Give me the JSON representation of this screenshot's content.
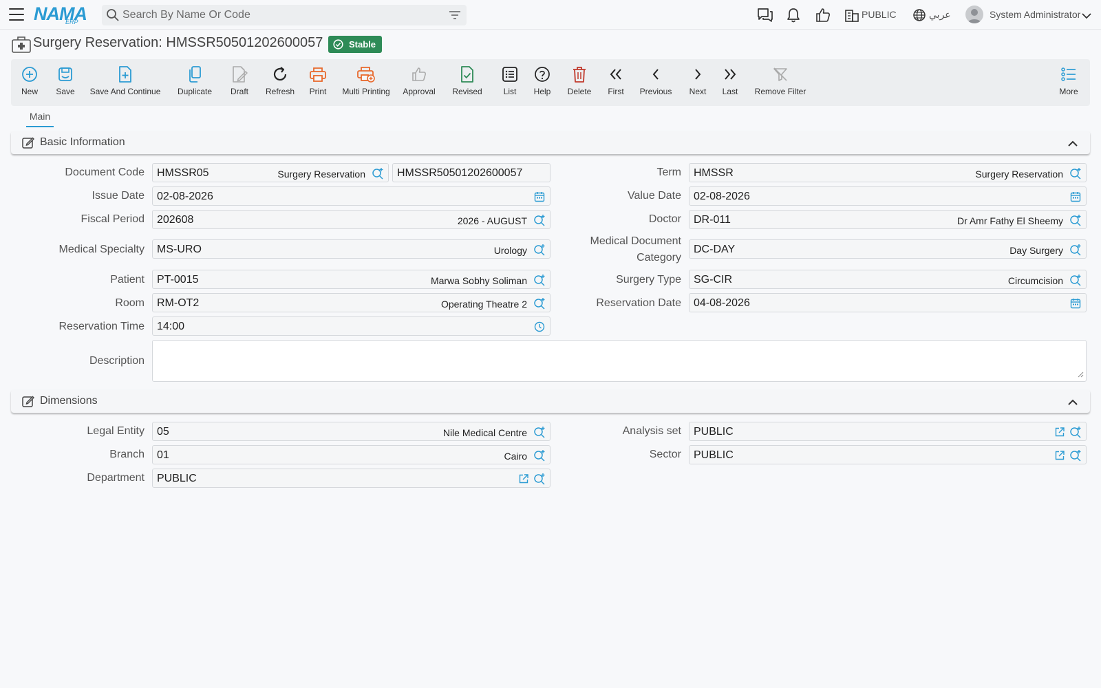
{
  "header": {
    "logo_main": "NAMA",
    "logo_sub": "ERP",
    "search_placeholder": "Search By Name Or Code",
    "org": "PUBLIC",
    "language": "عربي",
    "user": "System Administrator",
    "icons": [
      "menu-icon",
      "search-icon",
      "filter-icon",
      "chat-icon",
      "bell-icon",
      "thumbs-up-icon",
      "building-icon",
      "globe-icon",
      "user-icon",
      "chevron-down-icon"
    ]
  },
  "page": {
    "title": "Surgery Reservation: HMSSR50501202600057",
    "status": "Stable",
    "status_color": "#2e8b57"
  },
  "toolbar": {
    "new": "New",
    "save": "Save",
    "save_continue": "Save And Continue",
    "duplicate": "Duplicate",
    "draft": "Draft",
    "refresh": "Refresh",
    "print": "Print",
    "multi_printing": "Multi Printing",
    "approval": "Approval",
    "revised": "Revised",
    "list": "List",
    "help": "Help",
    "delete": "Delete",
    "first": "First",
    "previous": "Previous",
    "next": "Next",
    "last": "Last",
    "remove_filter": "Remove Filter",
    "more": "More"
  },
  "tabs": {
    "main": "Main"
  },
  "basic": {
    "title": "Basic Information",
    "document_code": {
      "label": "Document Code",
      "value": "HMSSR05",
      "desc": "Surgery Reservation",
      "code": "HMSSR50501202600057"
    },
    "issue_date": {
      "label": "Issue Date",
      "value": "02-08-2026"
    },
    "fiscal_period": {
      "label": "Fiscal Period",
      "value": "202608",
      "desc": "2026 - AUGUST"
    },
    "medical_specialty": {
      "label": "Medical Specialty",
      "value": "MS-URO",
      "desc": "Urology"
    },
    "patient": {
      "label": "Patient",
      "value": "PT-0015",
      "desc": "Marwa Sobhy Soliman"
    },
    "room": {
      "label": "Room",
      "value": "RM-OT2",
      "desc": "Operating Theatre 2"
    },
    "reservation_time": {
      "label": "Reservation Time",
      "value": "14:00"
    },
    "term": {
      "label": "Term",
      "value": "HMSSR",
      "desc": "Surgery Reservation"
    },
    "value_date": {
      "label": "Value Date",
      "value": "02-08-2026"
    },
    "doctor": {
      "label": "Doctor",
      "value": "DR-011",
      "desc": "Dr Amr Fathy El Sheemy"
    },
    "medical_document_category": {
      "label_line1": "Medical Document",
      "label_line2": "Category",
      "value": "DC-DAY",
      "desc": "Day Surgery"
    },
    "surgery_type": {
      "label": "Surgery Type",
      "value": "SG-CIR",
      "desc": "Circumcision"
    },
    "reservation_date": {
      "label": "Reservation Date",
      "value": "04-08-2026"
    },
    "description": {
      "label": "Description",
      "value": ""
    }
  },
  "dimensions": {
    "title": "Dimensions",
    "legal_entity": {
      "label": "Legal Entity",
      "value": "05",
      "desc": "Nile Medical Centre"
    },
    "branch": {
      "label": "Branch",
      "value": "01",
      "desc": "Cairo"
    },
    "department": {
      "label": "Department",
      "value": "PUBLIC"
    },
    "analysis_set": {
      "label": "Analysis set",
      "value": "PUBLIC"
    },
    "sector": {
      "label": "Sector",
      "value": "PUBLIC"
    }
  },
  "colors": {
    "accent": "#2b9bd3",
    "print": "#e8692c",
    "revised": "#2e8b57",
    "delete": "#c0392b",
    "icon_muted": "#aaaaaa"
  }
}
